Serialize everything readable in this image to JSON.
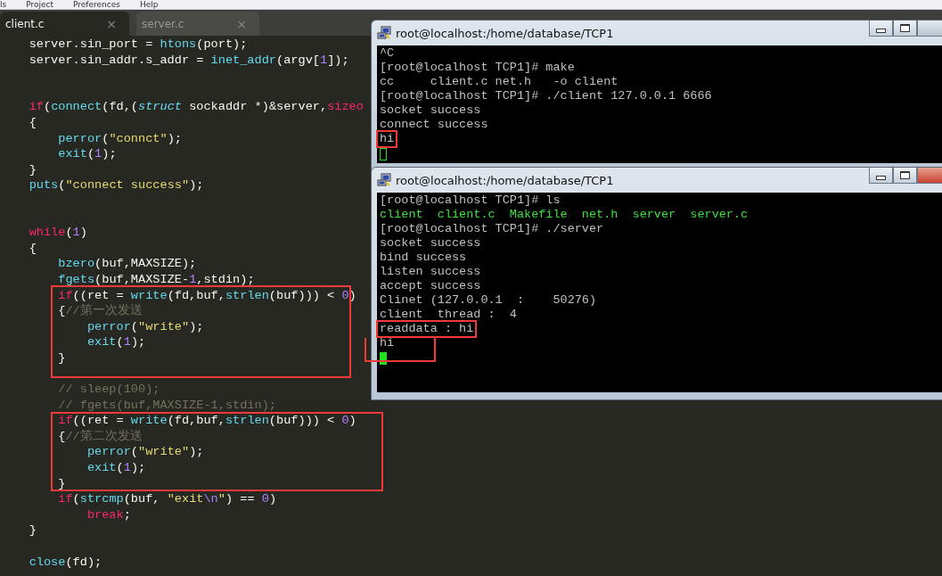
{
  "menu_bar": {
    "items": [
      "ls",
      "Project",
      "Preferences",
      "Help"
    ]
  },
  "editor": {
    "tabs": [
      {
        "label": "client.c",
        "close": "×",
        "selected": true
      },
      {
        "label": "server.c",
        "close": "×",
        "selected": false
      }
    ],
    "lines": [
      {
        "kind": "code",
        "tokens": [
          {
            "kind": "plain",
            "text": "    server.sin_port = "
          },
          {
            "kind": "function",
            "text": "htons"
          },
          {
            "kind": "plain",
            "text": "(port);"
          }
        ]
      },
      {
        "kind": "code",
        "tokens": [
          {
            "kind": "plain",
            "text": "    server.sin_addr.s_addr = "
          },
          {
            "kind": "function",
            "text": "inet_addr"
          },
          {
            "kind": "plain",
            "text": "(argv["
          },
          {
            "kind": "number",
            "text": "1"
          },
          {
            "kind": "plain",
            "text": "]);"
          }
        ]
      },
      {
        "kind": "blank"
      },
      {
        "kind": "blank"
      },
      {
        "kind": "code",
        "tokens": [
          {
            "kind": "keyword",
            "text": "    if"
          },
          {
            "kind": "plain",
            "text": "("
          },
          {
            "kind": "function",
            "text": "connect"
          },
          {
            "kind": "plain",
            "text": "(fd,("
          },
          {
            "kind": "type",
            "text": "struct"
          },
          {
            "kind": "plain",
            "text": " sockaddr *)&server,"
          },
          {
            "kind": "keyword",
            "text": "sizeo"
          }
        ]
      },
      {
        "kind": "code",
        "tokens": [
          {
            "kind": "plain",
            "text": "    {"
          }
        ]
      },
      {
        "kind": "code",
        "tokens": [
          {
            "kind": "function",
            "text": "        perror"
          },
          {
            "kind": "plain",
            "text": "("
          },
          {
            "kind": "string",
            "text": "\"connct\""
          },
          {
            "kind": "plain",
            "text": ");"
          }
        ]
      },
      {
        "kind": "code",
        "tokens": [
          {
            "kind": "function",
            "text": "        exit"
          },
          {
            "kind": "plain",
            "text": "("
          },
          {
            "kind": "number",
            "text": "1"
          },
          {
            "kind": "plain",
            "text": ");"
          }
        ]
      },
      {
        "kind": "code",
        "tokens": [
          {
            "kind": "plain",
            "text": "    }"
          }
        ]
      },
      {
        "kind": "code",
        "tokens": [
          {
            "kind": "function",
            "text": "    puts"
          },
          {
            "kind": "plain",
            "text": "("
          },
          {
            "kind": "string",
            "text": "\"connect success\""
          },
          {
            "kind": "plain",
            "text": ");"
          }
        ]
      },
      {
        "kind": "blank"
      },
      {
        "kind": "blank"
      },
      {
        "kind": "code",
        "tokens": [
          {
            "kind": "keyword",
            "text": "    while"
          },
          {
            "kind": "plain",
            "text": "("
          },
          {
            "kind": "number",
            "text": "1"
          },
          {
            "kind": "plain",
            "text": ")"
          }
        ]
      },
      {
        "kind": "code",
        "tokens": [
          {
            "kind": "plain",
            "text": "    {"
          }
        ]
      },
      {
        "kind": "code",
        "tokens": [
          {
            "kind": "function",
            "text": "        bzero"
          },
          {
            "kind": "plain",
            "text": "(buf,MAXSIZE);"
          }
        ]
      },
      {
        "kind": "code",
        "tokens": [
          {
            "kind": "function",
            "text": "        fgets"
          },
          {
            "kind": "plain",
            "text": "(buf,MAXSIZE-"
          },
          {
            "kind": "number",
            "text": "1"
          },
          {
            "kind": "plain",
            "text": ",stdin);"
          }
        ]
      },
      {
        "kind": "code",
        "tokens": [
          {
            "kind": "keyword",
            "text": "        if"
          },
          {
            "kind": "plain",
            "text": "((ret = "
          },
          {
            "kind": "function",
            "text": "write"
          },
          {
            "kind": "plain",
            "text": "(fd,buf,"
          },
          {
            "kind": "function",
            "text": "strlen"
          },
          {
            "kind": "plain",
            "text": "(buf))) < "
          },
          {
            "kind": "number",
            "text": "0"
          },
          {
            "kind": "plain",
            "text": ")"
          }
        ]
      },
      {
        "kind": "code",
        "tokens": [
          {
            "kind": "plain",
            "text": "        {"
          },
          {
            "kind": "comment",
            "text": "//第一次发送"
          }
        ]
      },
      {
        "kind": "code",
        "tokens": [
          {
            "kind": "function",
            "text": "            perror"
          },
          {
            "kind": "plain",
            "text": "("
          },
          {
            "kind": "string",
            "text": "\"write\""
          },
          {
            "kind": "plain",
            "text": ");"
          }
        ]
      },
      {
        "kind": "code",
        "tokens": [
          {
            "kind": "function",
            "text": "            exit"
          },
          {
            "kind": "plain",
            "text": "("
          },
          {
            "kind": "number",
            "text": "1"
          },
          {
            "kind": "plain",
            "text": ");"
          }
        ]
      },
      {
        "kind": "code",
        "tokens": [
          {
            "kind": "plain",
            "text": "        }"
          }
        ]
      },
      {
        "kind": "blank"
      },
      {
        "kind": "code",
        "tokens": [
          {
            "kind": "comment",
            "text": "        // sleep(100);"
          }
        ]
      },
      {
        "kind": "code",
        "tokens": [
          {
            "kind": "comment",
            "text": "        // fgets(buf,MAXSIZE-1,stdin);"
          }
        ]
      },
      {
        "kind": "code",
        "tokens": [
          {
            "kind": "keyword",
            "text": "        if"
          },
          {
            "kind": "plain",
            "text": "((ret = "
          },
          {
            "kind": "function",
            "text": "write"
          },
          {
            "kind": "plain",
            "text": "(fd,buf,"
          },
          {
            "kind": "function",
            "text": "strlen"
          },
          {
            "kind": "plain",
            "text": "(buf))) < "
          },
          {
            "kind": "number",
            "text": "0"
          },
          {
            "kind": "plain",
            "text": ")"
          }
        ]
      },
      {
        "kind": "code",
        "tokens": [
          {
            "kind": "plain",
            "text": "        {"
          },
          {
            "kind": "comment",
            "text": "//第二次发送"
          }
        ]
      },
      {
        "kind": "code",
        "tokens": [
          {
            "kind": "function",
            "text": "            perror"
          },
          {
            "kind": "plain",
            "text": "("
          },
          {
            "kind": "string",
            "text": "\"write\""
          },
          {
            "kind": "plain",
            "text": ");"
          }
        ]
      },
      {
        "kind": "code",
        "tokens": [
          {
            "kind": "function",
            "text": "            exit"
          },
          {
            "kind": "plain",
            "text": "("
          },
          {
            "kind": "number",
            "text": "1"
          },
          {
            "kind": "plain",
            "text": ");"
          }
        ]
      },
      {
        "kind": "code",
        "tokens": [
          {
            "kind": "plain",
            "text": "        }"
          }
        ]
      },
      {
        "kind": "code",
        "tokens": [
          {
            "kind": "keyword",
            "text": "        if"
          },
          {
            "kind": "plain",
            "text": "("
          },
          {
            "kind": "function",
            "text": "strcmp"
          },
          {
            "kind": "plain",
            "text": "(buf, "
          },
          {
            "kind": "string",
            "text": "\"exit"
          },
          {
            "kind": "number",
            "text": "\\n"
          },
          {
            "kind": "string",
            "text": "\""
          },
          {
            "kind": "plain",
            "text": ") == "
          },
          {
            "kind": "number",
            "text": "0"
          },
          {
            "kind": "plain",
            "text": ")"
          }
        ]
      },
      {
        "kind": "code",
        "tokens": [
          {
            "kind": "keyword",
            "text": "            break"
          },
          {
            "kind": "plain",
            "text": ";"
          }
        ]
      },
      {
        "kind": "code",
        "tokens": [
          {
            "kind": "plain",
            "text": "    }"
          }
        ]
      },
      {
        "kind": "blank"
      },
      {
        "kind": "code",
        "tokens": [
          {
            "kind": "function",
            "text": "    close"
          },
          {
            "kind": "plain",
            "text": "(fd);"
          }
        ]
      }
    ]
  },
  "terminals": [
    {
      "title": "root@localhost:/home/database/TCP1",
      "focused": false,
      "lines": [
        {
          "kind": "output",
          "text": "^C",
          "highlighted": false
        },
        {
          "kind": "output",
          "text": "[root@localhost TCP1]# make",
          "highlighted": false
        },
        {
          "kind": "output",
          "text": "cc     client.c net.h   -o client",
          "highlighted": false
        },
        {
          "kind": "output",
          "text": "[root@localhost TCP1]# ./client 127.0.0.1 6666",
          "highlighted": false
        },
        {
          "kind": "output",
          "text": "socket success",
          "highlighted": false
        },
        {
          "kind": "output",
          "text": "connect success",
          "highlighted": false
        },
        {
          "kind": "output",
          "text": "hi",
          "highlighted": true
        }
      ]
    },
    {
      "title": "root@localhost:/home/database/TCP1",
      "focused": true,
      "lines": [
        {
          "kind": "output",
          "text": "[root@localhost TCP1]# ls",
          "highlighted": false
        },
        {
          "kind": "listing",
          "text": "client  client.c  Makefile  net.h  server  server.c",
          "highlighted": false
        },
        {
          "kind": "output",
          "text": "[root@localhost TCP1]# ./server",
          "highlighted": false
        },
        {
          "kind": "output",
          "text": "socket success",
          "highlighted": false
        },
        {
          "kind": "output",
          "text": "bind success",
          "highlighted": false
        },
        {
          "kind": "output",
          "text": "listen success",
          "highlighted": false
        },
        {
          "kind": "output",
          "text": "accept success",
          "highlighted": false
        },
        {
          "kind": "output",
          "text": "Clinet (127.0.0.1  :    50276)",
          "highlighted": false
        },
        {
          "kind": "output",
          "text": "client  thread :  4",
          "highlighted": false
        },
        {
          "kind": "output",
          "text": "readdata : hi",
          "highlighted": true
        },
        {
          "kind": "output",
          "text": "hi",
          "highlighted": false
        }
      ]
    }
  ]
}
